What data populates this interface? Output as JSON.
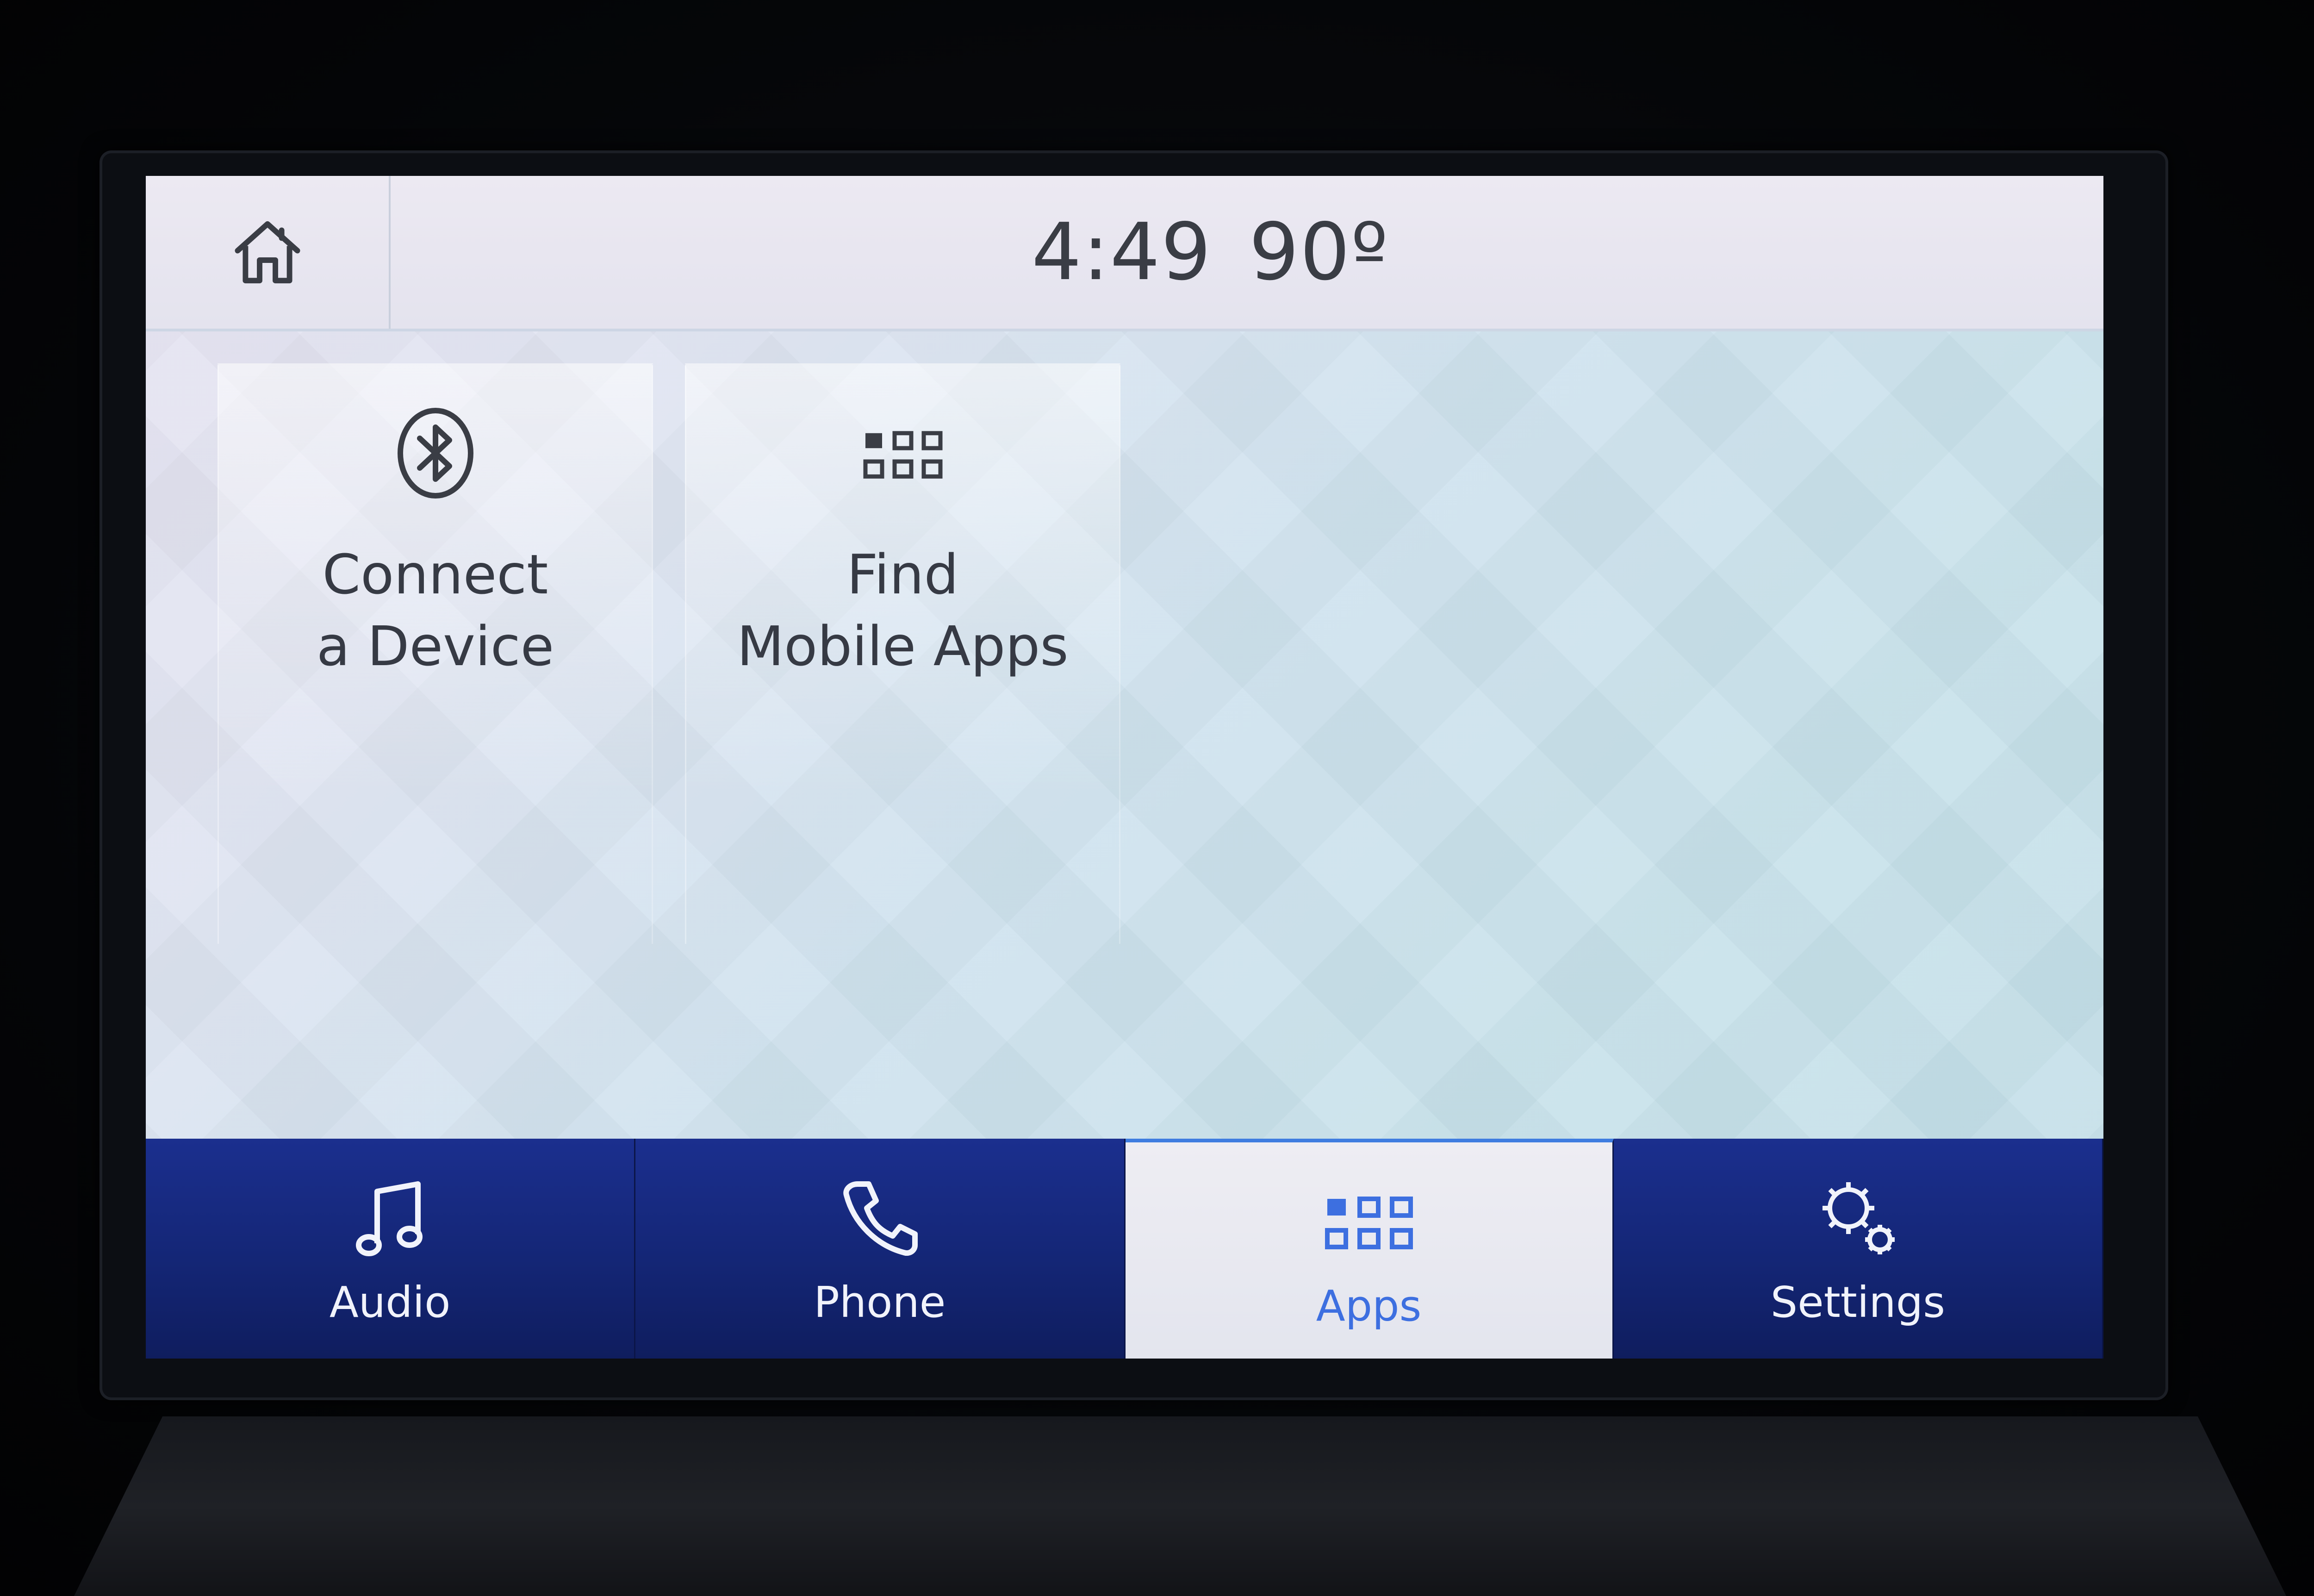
{
  "status_bar": {
    "home_icon": "home-icon",
    "time": "4:49",
    "temperature": "90º"
  },
  "tiles": [
    {
      "icon": "bluetooth-icon",
      "label": "Connect\na Device"
    },
    {
      "icon": "apps-grid-icon",
      "label": "Find\nMobile Apps"
    }
  ],
  "nav": {
    "items": [
      {
        "icon": "music-note-icon",
        "label": "Audio",
        "active": false
      },
      {
        "icon": "phone-icon",
        "label": "Phone",
        "active": false
      },
      {
        "icon": "apps-grid-icon",
        "label": "Apps",
        "active": true
      },
      {
        "icon": "gears-icon",
        "label": "Settings",
        "active": false
      }
    ]
  },
  "colors": {
    "nav_background": "#142676",
    "active_accent": "#3d6fe0",
    "text_dark": "#363a44",
    "text_light": "#f1f3fb"
  }
}
